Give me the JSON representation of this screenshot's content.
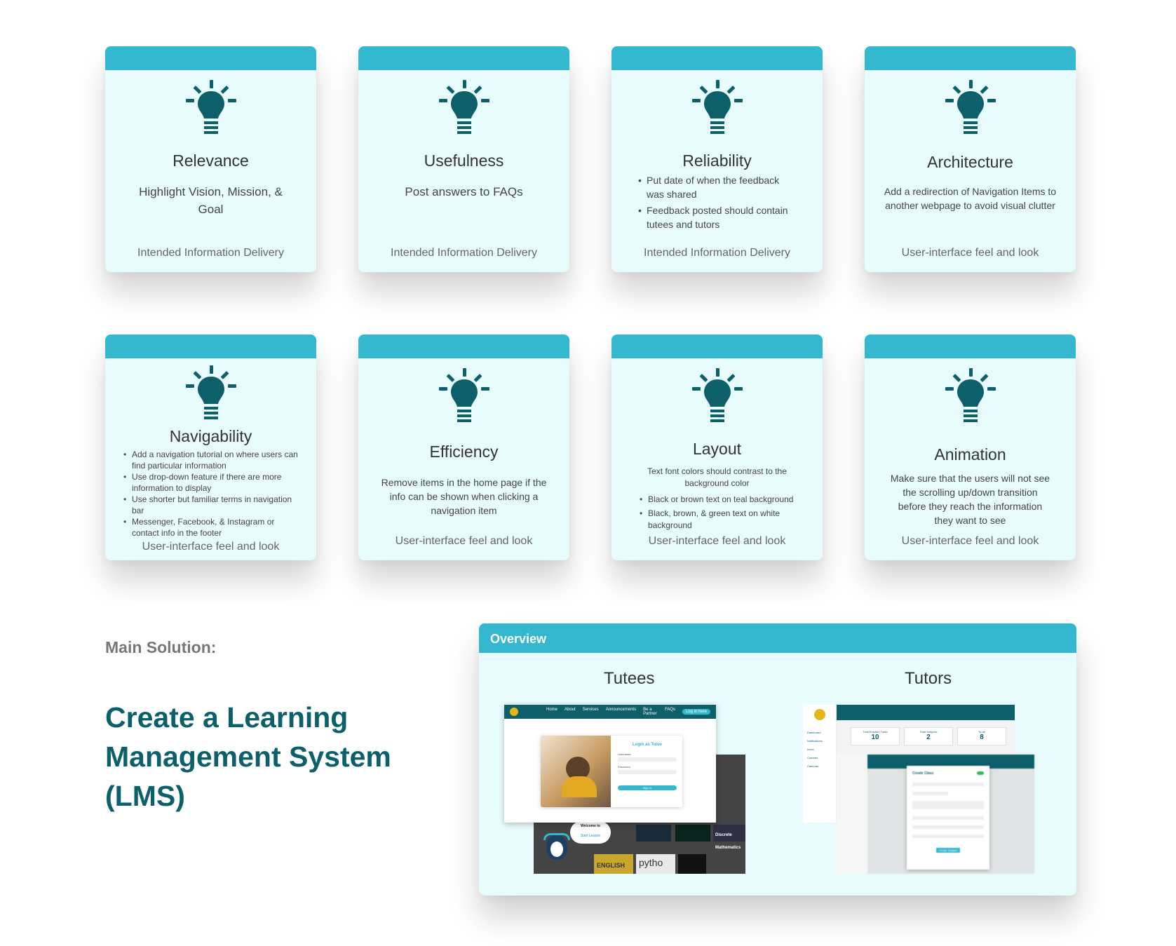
{
  "cards": [
    {
      "title": "Relevance",
      "desc": "Highlight Vision, Mission, & Goal",
      "category": "Intended Information Delivery"
    },
    {
      "title": "Usefulness",
      "desc": "Post answers to FAQs",
      "category": "Intended Information Delivery"
    },
    {
      "title": "Reliability",
      "bullets": [
        "Put date of when the feedback was shared",
        "Feedback posted should contain tutees and tutors"
      ],
      "category": "Intended Information Delivery"
    },
    {
      "title": "Architecture",
      "desc": "Add a redirection of Navigation Items to another webpage to avoid visual clutter",
      "category": "User-interface feel and look"
    },
    {
      "title": "Navigability",
      "bullets": [
        "Add a navigation tutorial on where users can find particular information",
        "Use drop-down feature if there are more information to display",
        "Use shorter but familiar terms in navigation bar",
        "Messenger, Facebook, & Instagram or contact info in the footer"
      ],
      "category": "User-interface feel and look"
    },
    {
      "title": "Efficiency",
      "desc": "Remove items in the home page if the info can be shown when clicking a navigation item",
      "category": "User-interface feel and look"
    },
    {
      "title": "Layout",
      "desc": "Text font colors should contrast to the background color",
      "bullets": [
        "Black or brown text on teal background",
        "Black, brown, & green text on white background"
      ],
      "category": "User-interface feel and look"
    },
    {
      "title": "Animation",
      "desc": "Make sure that the users will not see the scrolling up/down transition before they reach the information they want to see",
      "category": "User-interface feel and look"
    }
  ],
  "main": {
    "label": "Main Solution:",
    "title": "Create a Learning Management System (LMS)"
  },
  "overview": {
    "header": "Overview",
    "tutees_title": "Tutees",
    "tutors_title": "Tutors",
    "tutee_mock": {
      "nav": [
        "Home",
        "About",
        "Services",
        "Announcements",
        "Be a Partner",
        "FAQs"
      ],
      "nav_button": "Log in here",
      "login_title": "Login as Tutee",
      "username_label": "Username",
      "password_label": "Password",
      "signin": "Sign in",
      "bubble_title": "Welcome to",
      "bubble_cta": "Start Lesson",
      "tile_discrete": "Discrete Mathematics",
      "tile_english": "ENGLISH",
      "tile_python": "pytho"
    },
    "tutor_mock": {
      "sidebar": [
        "Dashboard",
        "Notifications",
        "Inbox",
        "Courses",
        "Calendar"
      ],
      "stats": [
        {
          "label": "Total Enrolled Tutee",
          "value": "10"
        },
        {
          "label": "Total Subjects",
          "value": "2"
        },
        {
          "label": "To do",
          "value": "8"
        }
      ],
      "modal_title": "Create Class",
      "modal_button": "Create Subject"
    }
  },
  "colors": {
    "teal_header": "#33b8cf",
    "card_bg": "#e8fbfd",
    "bulb": "#0d5f6a",
    "title_dark_teal": "#0d5f6a"
  }
}
